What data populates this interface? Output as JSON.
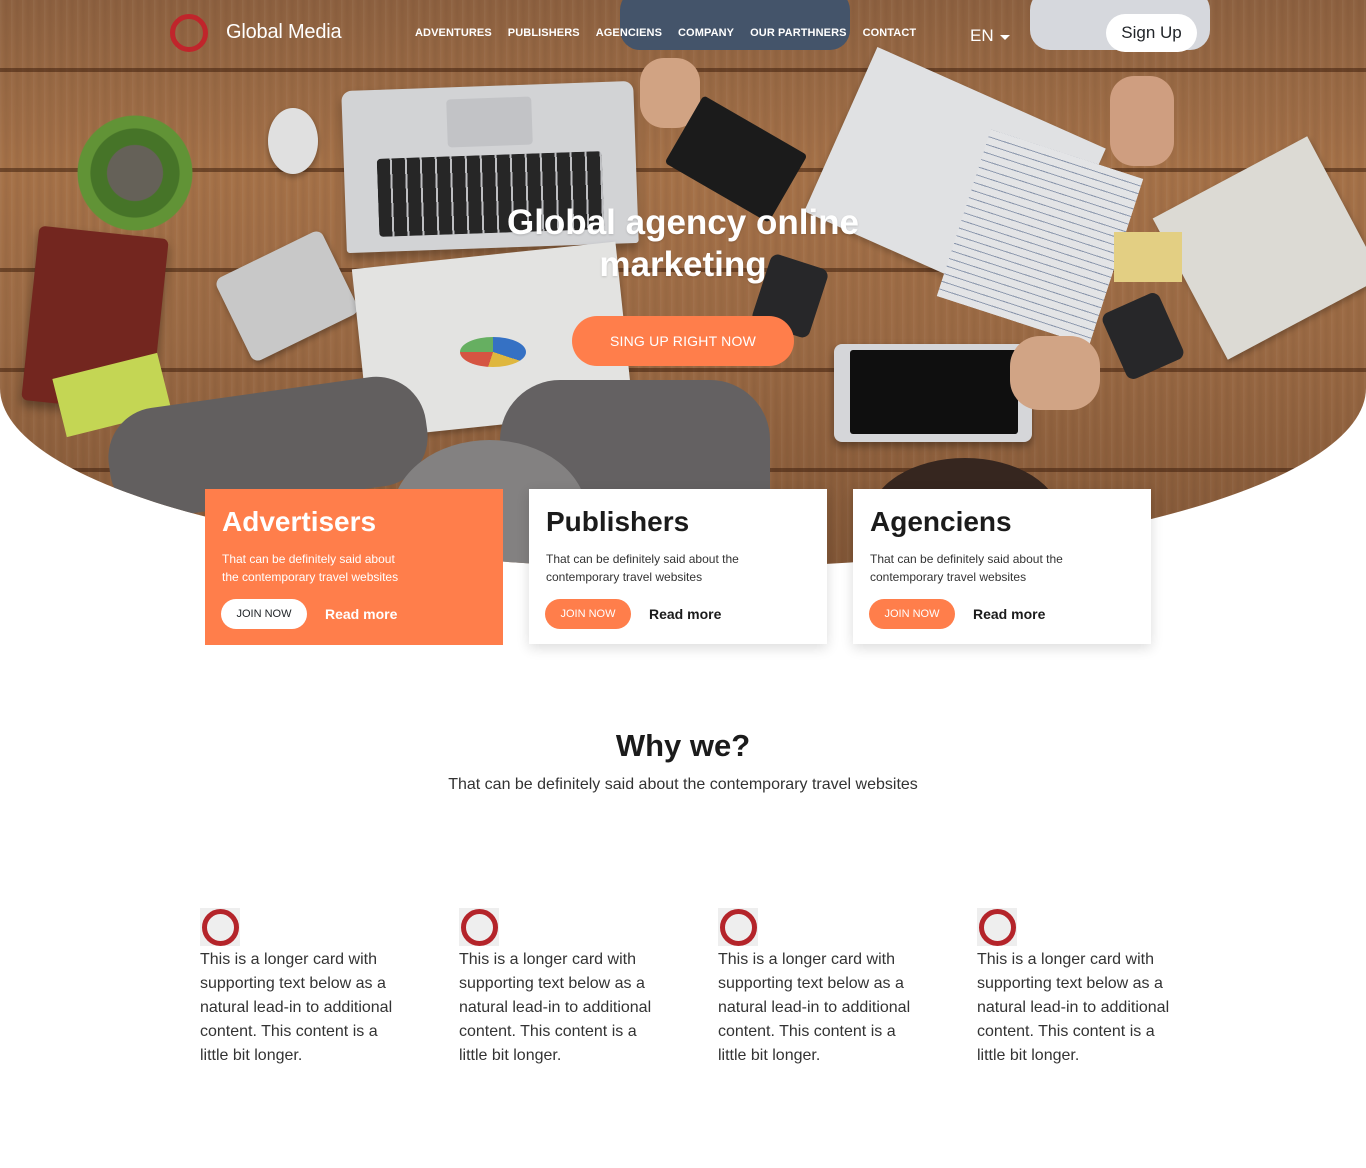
{
  "brand": {
    "name": "Global Media",
    "logo_icon": "ring-logo-icon",
    "accent_color": "#c0252b"
  },
  "nav": {
    "items": [
      "ADVENTURES",
      "PUBLISHERS",
      "AGENCIENS",
      "COMPANY",
      "OUR PARTHNERS",
      "CONTACT"
    ],
    "language": "EN",
    "signup_label": "Sign Up"
  },
  "hero": {
    "title": "Global agency online marketing",
    "cta_label": "SING UP RIGHT NOW",
    "cta_color": "#ff7e4b"
  },
  "cards": [
    {
      "title": "Advertisers",
      "text": "That can be definitely said about the contemporary travel websites",
      "join_label": "JOIN NOW",
      "read_more": "Read more",
      "featured": true
    },
    {
      "title": "Publishers",
      "text": "That can be definitely said about the contemporary travel websites",
      "join_label": "JOIN NOW",
      "read_more": "Read more",
      "featured": false
    },
    {
      "title": "Agenciens",
      "text": "That can be definitely said about the contemporary travel websites",
      "join_label": "JOIN NOW",
      "read_more": "Read more",
      "featured": false
    }
  ],
  "why": {
    "title": "Why we?",
    "subtitle": "That can be definitely said about the contemporary travel websites",
    "features": [
      {
        "icon": "ring-icon",
        "text": "This is a longer card with supporting text below as a natural lead-in to additional content. This content is a little bit longer."
      },
      {
        "icon": "ring-icon",
        "text": "This is a longer card with supporting text below as a natural lead-in to additional content. This content is a little bit longer."
      },
      {
        "icon": "ring-icon",
        "text": "This is a longer card with supporting text below as a natural lead-in to additional content. This content is a little bit longer."
      },
      {
        "icon": "ring-icon",
        "text": "This is a longer card with supporting text below as a natural lead-in to additional content. This content is a little bit longer."
      }
    ]
  }
}
